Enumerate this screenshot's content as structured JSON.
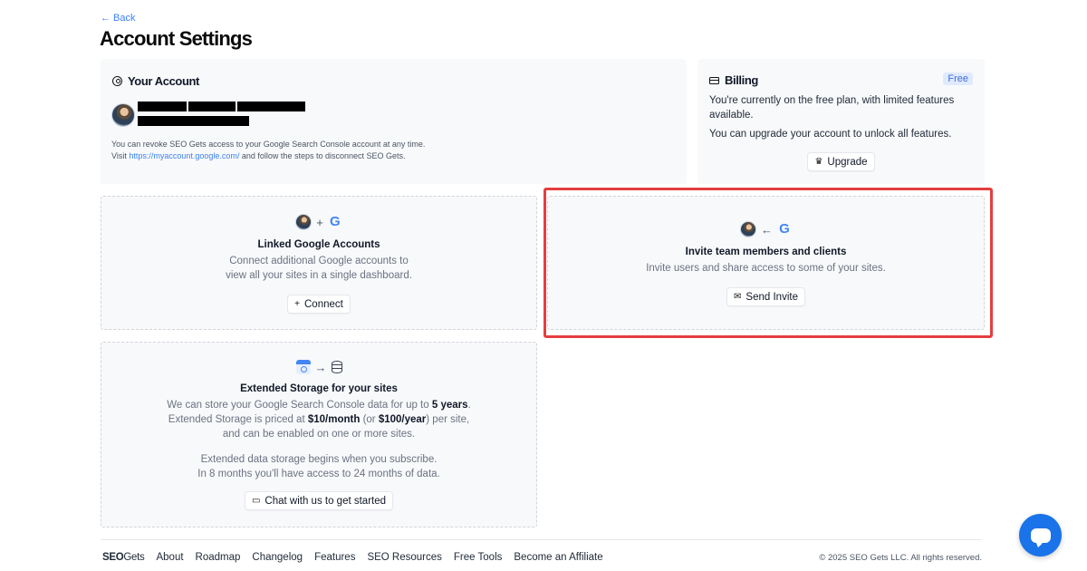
{
  "nav": {
    "back_label": "← Back"
  },
  "page": {
    "title": "Account Settings"
  },
  "account": {
    "heading": "Your Account",
    "revoke_text": "You can revoke SEO Gets access to your Google Search Console account at any time.",
    "visit_prefix": "Visit ",
    "visit_link": "https://myaccount.google.com/",
    "visit_suffix": " and follow the steps to disconnect SEO Gets."
  },
  "billing": {
    "heading": "Billing",
    "plan_badge": "Free",
    "plan_text": "You're currently on the free plan, with limited features available.",
    "upgrade_text": "You can upgrade your account to unlock all features.",
    "upgrade_button": "Upgrade",
    "upgrade_icon": "♛"
  },
  "linked": {
    "operator": "+",
    "title": "Linked Google Accounts",
    "desc_line1": "Connect additional Google accounts to",
    "desc_line2": "view all your sites in a single dashboard.",
    "button": "Connect",
    "button_icon": "+"
  },
  "invite": {
    "operator": "←",
    "title": "Invite team members and clients",
    "desc": "Invite users and share access to some of your sites.",
    "button": "Send Invite",
    "button_icon": "✉"
  },
  "storage": {
    "operator": "→",
    "title": "Extended Storage for your sites",
    "line1_pre": "We can store your Google Search Console data for up to ",
    "line1_bold": "5 years",
    "line1_post": ".",
    "line2_pre": "Extended Storage is priced at ",
    "line2_bold1": "$10/month",
    "line2_mid": " (or ",
    "line2_bold2": "$100/year",
    "line2_post": ") per site,",
    "line3": "and can be enabled on one or more sites.",
    "line4": "Extended data storage begins when you subscribe.",
    "line5": "In 8 months you'll have access to 24 months of data.",
    "button": "Chat with us to get started",
    "button_icon": "▭"
  },
  "footer": {
    "brand_bold": "SEO",
    "brand_rest": "Gets",
    "links": [
      "About",
      "Roadmap",
      "Changelog",
      "Features",
      "SEO Resources",
      "Free Tools",
      "Become an Affiliate"
    ],
    "copyright": "© 2025 SEO Gets LLC. All rights reserved."
  },
  "google_letter": "G",
  "colors": {
    "accent": "#3b82f6",
    "highlight": "#e53e3e",
    "chat_fab": "#1a73e8"
  }
}
